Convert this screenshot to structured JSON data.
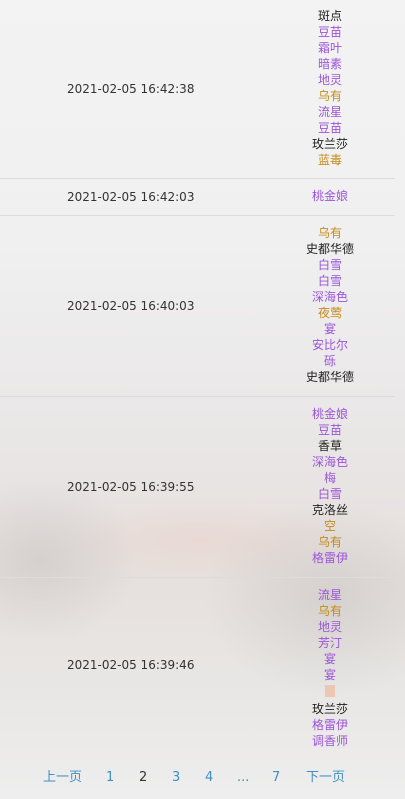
{
  "rows": [
    {
      "time": "2021-02-05 16:42:38",
      "names": [
        {
          "text": "斑点",
          "color": "black"
        },
        {
          "text": "豆苗",
          "color": "purple"
        },
        {
          "text": "霜叶",
          "color": "purple"
        },
        {
          "text": "暗素",
          "color": "purple"
        },
        {
          "text": "地灵",
          "color": "purple"
        },
        {
          "text": "乌有",
          "color": "gold"
        },
        {
          "text": "流星",
          "color": "purple"
        },
        {
          "text": "豆苗",
          "color": "purple"
        },
        {
          "text": "玫兰莎",
          "color": "black"
        },
        {
          "text": "蓝毒",
          "color": "gold"
        }
      ]
    },
    {
      "time": "2021-02-05 16:42:03",
      "names": [
        {
          "text": "桃金娘",
          "color": "purple"
        }
      ]
    },
    {
      "time": "2021-02-05 16:40:03",
      "names": [
        {
          "text": "乌有",
          "color": "gold"
        },
        {
          "text": "史都华德",
          "color": "black"
        },
        {
          "text": "白雪",
          "color": "purple"
        },
        {
          "text": "白雪",
          "color": "purple"
        },
        {
          "text": "深海色",
          "color": "purple"
        },
        {
          "text": "夜莺",
          "color": "gold"
        },
        {
          "text": "宴",
          "color": "purple"
        },
        {
          "text": "安比尔",
          "color": "purple"
        },
        {
          "text": "砾",
          "color": "purple"
        },
        {
          "text": "史都华德",
          "color": "black"
        }
      ]
    },
    {
      "time": "2021-02-05 16:39:55",
      "names": [
        {
          "text": "桃金娘",
          "color": "purple"
        },
        {
          "text": "豆苗",
          "color": "purple"
        },
        {
          "text": "香草",
          "color": "black"
        },
        {
          "text": "深海色",
          "color": "purple"
        },
        {
          "text": "梅",
          "color": "purple"
        },
        {
          "text": "白雪",
          "color": "purple"
        },
        {
          "text": "克洛丝",
          "color": "black"
        },
        {
          "text": "空",
          "color": "gold"
        },
        {
          "text": "乌有",
          "color": "gold"
        },
        {
          "text": "格雷伊",
          "color": "purple"
        }
      ]
    },
    {
      "time": "2021-02-05 16:39:46",
      "names": [
        {
          "text": "流星",
          "color": "purple"
        },
        {
          "text": "乌有",
          "color": "gold"
        },
        {
          "text": "地灵",
          "color": "purple"
        },
        {
          "text": "芳汀",
          "color": "purple"
        },
        {
          "text": "宴",
          "color": "purple"
        },
        {
          "text": "宴",
          "color": "purple"
        },
        {
          "text": "",
          "color": "empty"
        },
        {
          "text": "玫兰莎",
          "color": "black"
        },
        {
          "text": "格雷伊",
          "color": "purple"
        },
        {
          "text": "调香师",
          "color": "purple"
        }
      ]
    }
  ],
  "pagination": {
    "prev": "上一页",
    "pages": [
      "1",
      "2",
      "3",
      "4",
      "...",
      "7"
    ],
    "current": "2",
    "next": "下一页"
  },
  "colors": {
    "black": "#222222",
    "purple": "#9b55d8",
    "gold": "#c48a1a"
  }
}
